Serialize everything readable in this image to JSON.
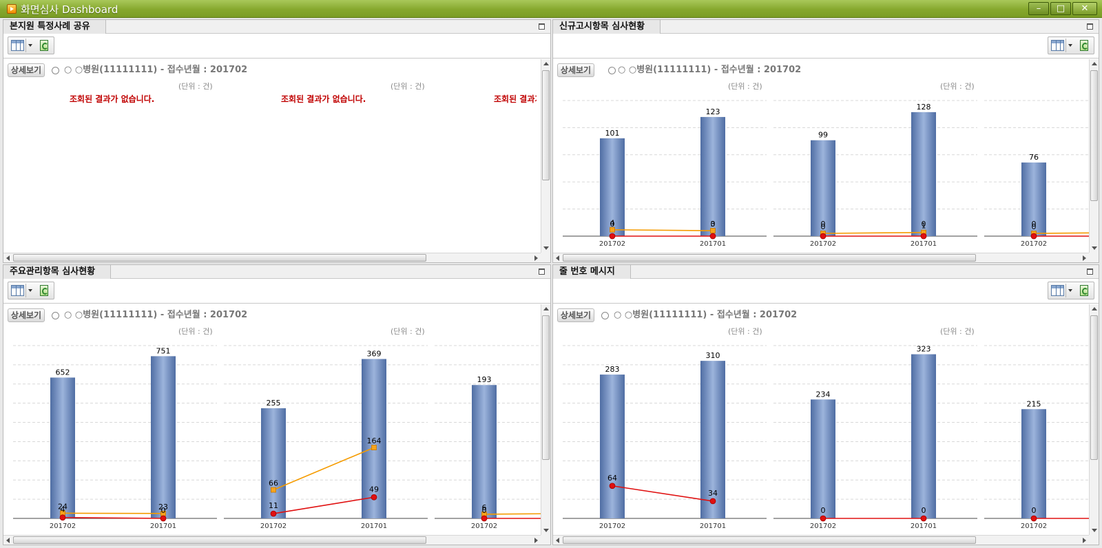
{
  "window": {
    "title": "화면심사 Dashboard",
    "min_label": "–",
    "max_label": "□",
    "close_label": "✕"
  },
  "common": {
    "detail_label": "상세보기",
    "hospital_label": "○ ○병원(11111111) - 접수년월 : 201702",
    "unit_label": "(단위 : 건)",
    "no_result": "조회된 결과가 없습니다."
  },
  "panels": [
    {
      "title": "본지원 특정사례 공유",
      "no_data": true
    },
    {
      "title": "신규고시항목 심사현황",
      "no_data": false
    },
    {
      "title": "주요관리항목 심사현황",
      "no_data": false
    },
    {
      "title": "줄 번호 메시지",
      "no_data": false
    }
  ],
  "colors": {
    "bar": "#6f8fc4",
    "line_orange": "#f59b00",
    "line_red": "#e01010",
    "no_data_text": "#c00000"
  },
  "chart_data": [
    {
      "type": "bar",
      "panel": "신규고시항목 심사현황",
      "groups": [
        {
          "categories": [
            "201702",
            "201701"
          ],
          "bars": [
            101,
            123
          ],
          "orange": [
            4,
            3
          ],
          "red": [
            0,
            0
          ]
        },
        {
          "categories": [
            "201702",
            "201701"
          ],
          "bars": [
            99,
            128
          ],
          "orange": [
            0,
            1
          ],
          "red": [
            0,
            0
          ]
        },
        {
          "categories": [
            "201702"
          ],
          "bars": [
            76
          ],
          "orange": [
            0
          ],
          "red": [
            0
          ]
        }
      ],
      "ylim": [
        0,
        140
      ]
    },
    {
      "type": "bar",
      "panel": "주요관리항목 심사현황",
      "groups": [
        {
          "categories": [
            "201702",
            "201701"
          ],
          "bars": [
            652,
            751
          ],
          "orange": [
            24,
            23
          ],
          "red": [
            4,
            0
          ]
        },
        {
          "categories": [
            "201702",
            "201701"
          ],
          "bars": [
            255,
            369
          ],
          "orange": [
            66,
            164
          ],
          "red": [
            11,
            49
          ]
        },
        {
          "categories": [
            "201702"
          ],
          "bars": [
            193
          ],
          "orange": [
            6
          ],
          "red": [
            0
          ]
        }
      ],
      "ylim": [
        0,
        800,
        0,
        400,
        0,
        250
      ]
    },
    {
      "type": "bar",
      "panel": "줄 번호 메시지",
      "groups": [
        {
          "categories": [
            "201702",
            "201701"
          ],
          "bars": [
            283,
            310
          ],
          "orange": [],
          "red": [
            64,
            34
          ]
        },
        {
          "categories": [
            "201702",
            "201701"
          ],
          "bars": [
            234,
            323
          ],
          "orange": [],
          "red": [
            0,
            0
          ]
        },
        {
          "categories": [
            "201702"
          ],
          "bars": [
            215
          ],
          "orange": [],
          "red": [
            0
          ]
        }
      ],
      "ylim": [
        0,
        340
      ]
    }
  ]
}
